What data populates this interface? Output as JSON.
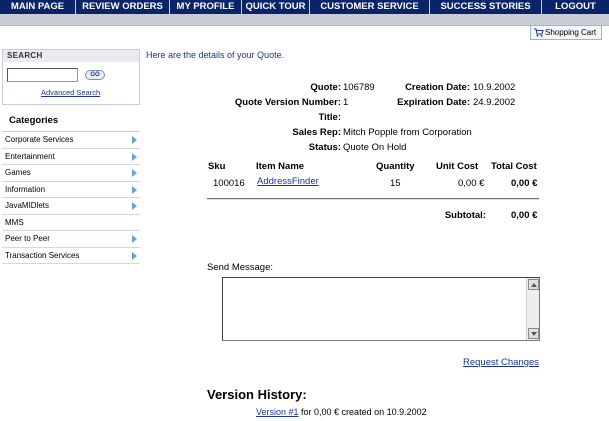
{
  "nav": {
    "items": [
      {
        "label": "MAIN PAGE"
      },
      {
        "label": "REVIEW ORDERS"
      },
      {
        "label": "MY PROFILE"
      },
      {
        "label": "QUICK TOUR"
      },
      {
        "label": "CUSTOMER SERVICE"
      },
      {
        "label": "SUCCESS STORIES"
      },
      {
        "label": "LOGOUT"
      }
    ]
  },
  "cart": {
    "label": "Shopping Cart",
    "icon": "shopping-cart-icon"
  },
  "search": {
    "title": "SEARCH",
    "input_value": "",
    "go_label": "GO",
    "advanced_label": "Advanced Search"
  },
  "categories": {
    "title": "Categories",
    "items": [
      {
        "label": "Corporate Services",
        "has_arrow": true
      },
      {
        "label": "Entertainment",
        "has_arrow": true
      },
      {
        "label": "Games",
        "has_arrow": true
      },
      {
        "label": "Information",
        "has_arrow": true
      },
      {
        "label": "JavaMIDlets",
        "has_arrow": true
      },
      {
        "label": "MMS",
        "has_arrow": false
      },
      {
        "label": "Peer to Peer",
        "has_arrow": true
      },
      {
        "label": "Transaction Services",
        "has_arrow": true
      }
    ]
  },
  "quote": {
    "intro": "Here are the details of your Quote.",
    "quote_label": "Quote:",
    "quote_value": "106789",
    "creation_label": "Creation Date:",
    "creation_value": "10.9.2002",
    "version_label": "Quote Version Number:",
    "version_value": "1",
    "expiration_label": "Expiration Date:",
    "expiration_value": "24.9.2002",
    "title_label": "Title:",
    "title_value": "",
    "salesrep_label": "Sales Rep:",
    "salesrep_value": "Mitch Popple from  Corporation",
    "status_label": "Status:",
    "status_value": "Quote On Hold"
  },
  "items_table": {
    "headers": {
      "sku": "Sku",
      "name": "Item Name",
      "quantity": "Quantity",
      "unit_cost": "Unit Cost",
      "total_cost": "Total Cost"
    },
    "rows": [
      {
        "sku": "100016",
        "name": "AddressFinder",
        "quantity": "15",
        "unit_cost": "0,00 €",
        "total_cost": "0,00 €"
      }
    ],
    "subtotal_label": "Subtotal:",
    "subtotal_value": "0,00 €"
  },
  "message": {
    "label": "Send Message:",
    "value": ""
  },
  "request_changes_label": "Request Changes",
  "version_history": {
    "title": "Version History:",
    "link_label": "Version #1",
    "suffix": " for 0,00 € created on 10.9.2002"
  },
  "colors": {
    "nav_bg": "#0a246a",
    "link": "#1a33a0",
    "band": "#c9cdd6"
  }
}
